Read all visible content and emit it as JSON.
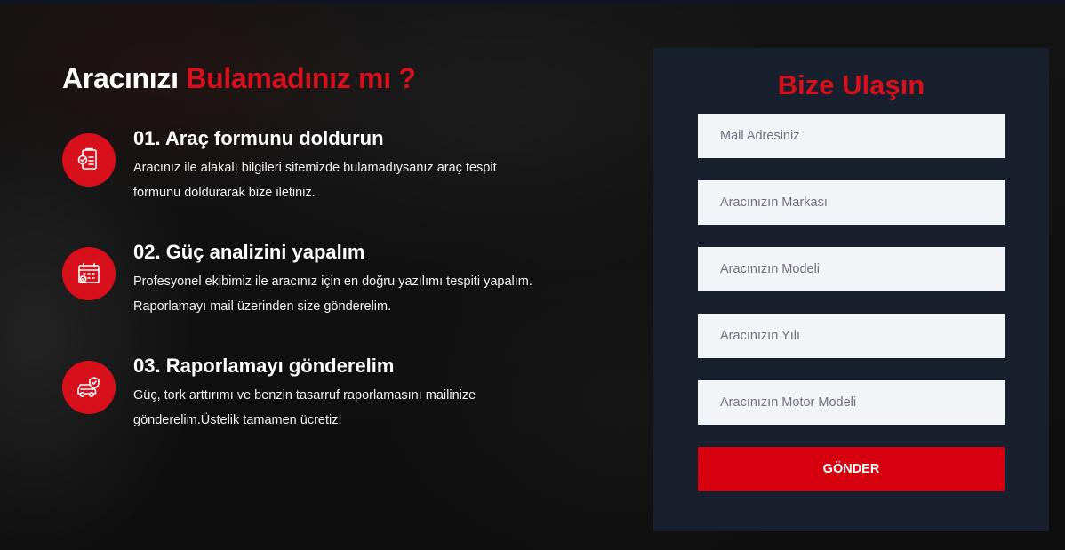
{
  "colors": {
    "accent": "#d7101c",
    "panel": "#18202d",
    "field": "#f3f4f7",
    "button": "#d7000f"
  },
  "heading": {
    "part1": "Aracınızı",
    "part2": "Bulamadınız mı ?"
  },
  "steps": [
    {
      "icon": "form-checklist-icon",
      "title": "01. Araç formunu doldurun",
      "desc": "Aracınız ile alakalı bilgileri sitemizde bulamadıysanız araç tespit formunu doldurarak bize iletiniz."
    },
    {
      "icon": "calendar-check-icon",
      "title": "02. Güç analizini yapalım",
      "desc": "Profesyonel ekibimiz ile aracınız için en doğru yazılımı tespiti yapalım. Raporlamayı mail üzerinden size gönderelim."
    },
    {
      "icon": "car-shield-icon",
      "title": "03. Raporlamayı gönderelim",
      "desc": "Güç, tork arttırımı ve benzin tasarruf raporlamasını mailinize gönderelim.Üstelik tamamen ücretiz!"
    }
  ],
  "form": {
    "title": "Bize Ulaşın",
    "fields": {
      "email": "Mail Adresiniz",
      "brand": "Aracınızın Markası",
      "model": "Aracınızın Modeli",
      "year": "Aracınızın Yılı",
      "engine": "Aracınızın Motor Modeli"
    },
    "submit": "GÖNDER"
  }
}
